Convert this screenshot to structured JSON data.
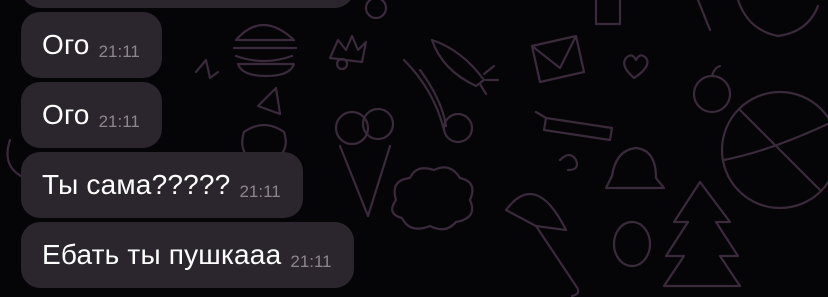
{
  "messages": [
    {
      "text": "Ого",
      "time": "21:11"
    },
    {
      "text": "Ого",
      "time": "21:11"
    },
    {
      "text": "Ты сама?????",
      "time": "21:11"
    },
    {
      "text": "Ебать ты пушкааа",
      "time": "21:11"
    }
  ],
  "colors": {
    "background": "#050407",
    "bubble": "#2b252d",
    "text": "#ffffff",
    "timestamp": "#8d858f",
    "wallpaper_doodle": "#3a2a3c"
  }
}
